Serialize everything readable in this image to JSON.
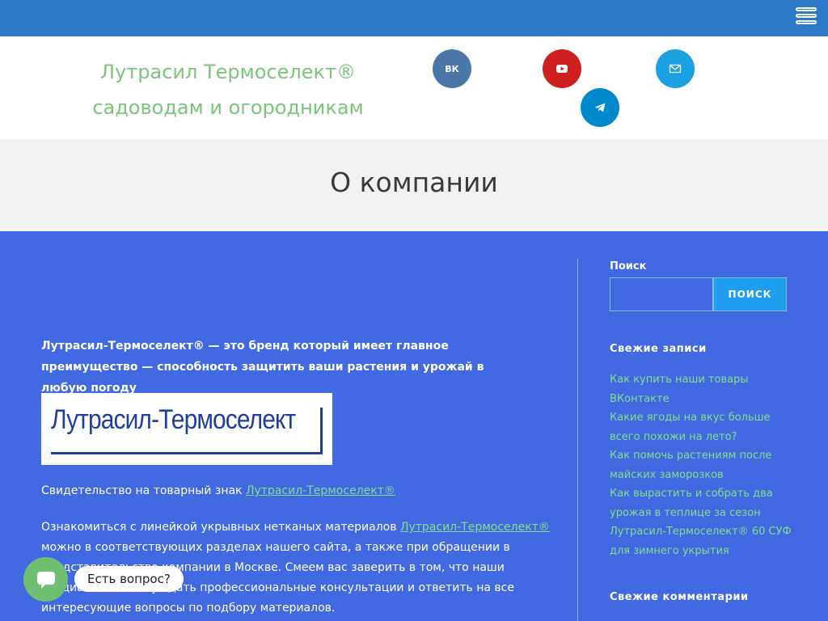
{
  "header": {
    "site_title": "Лутрасил Термоселект® садоводам и огородникам"
  },
  "social": [
    {
      "name": "vk",
      "label": "ВК",
      "color": "#4a76a8"
    },
    {
      "name": "youtube",
      "color": "#cd201f"
    },
    {
      "name": "email",
      "color": "#1ba1e2"
    },
    {
      "name": "telegram",
      "color": "#0088cc"
    }
  ],
  "page": {
    "title": "О компании"
  },
  "main": {
    "lead": "Лутрасил-Термоселект® — это бренд который имеет главное преимущество — способность защитить ваши растения и урожай в любую погоду",
    "logo_text": "Лутрасил-Термоселект",
    "p1_text": "Свидетельство на товарный знак ",
    "p1_link": "Лутрасил-Термоселект®",
    "p2_text_before": "Ознакомиться с линейкой укрывных нетканых материалов ",
    "p2_link": "Лутрасил-Термоселект®",
    "p2_text_after": " можно в соответствующих разделах нашего сайта, а также при обращении в представительство компании в Москве. Смеем вас заверить в том, что наши специалисты смогут дать профессиональные консультации и ответить на все интересующие вопросы по подбору материалов."
  },
  "sidebar": {
    "search_label": "Поиск",
    "search_button": "ПОИСК",
    "recent_posts_title": "Свежие записи",
    "recent_posts": [
      "Как купить наши товары ВКонтакте",
      "Какие ягоды на вкус больше всего похожи на лето?",
      "Как помочь растениям после майских заморозков",
      "Как вырастить и собрать два урожая в теплице за сезон",
      "Лутрасил-Термоселект® 60 СУФ для зимнего укрытия"
    ],
    "recent_comments_title": "Свежие комментарии"
  },
  "chat": {
    "prompt": "Есть вопрос?"
  },
  "colors": {
    "topbar": "#2a78c6",
    "content_bg": "#4169e1",
    "accent_green": "#7cc47a",
    "link_green": "#7ee08a",
    "search_button": "#1f9ef0"
  }
}
